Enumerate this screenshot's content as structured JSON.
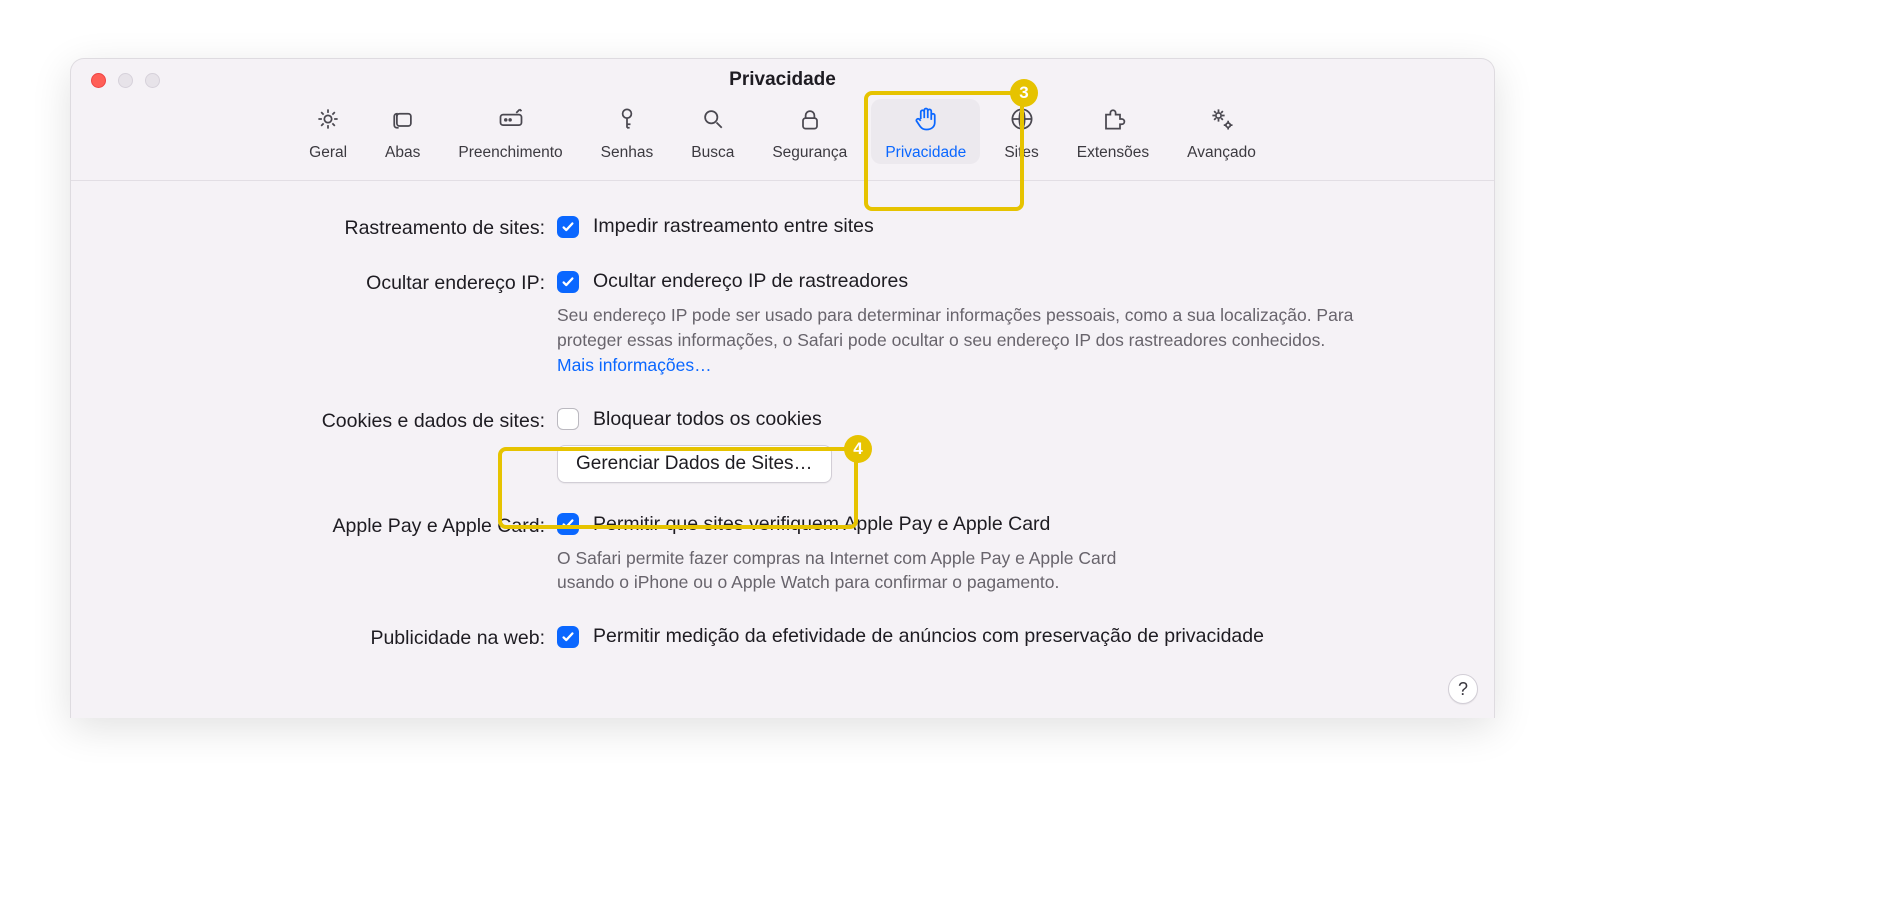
{
  "window": {
    "title": "Privacidade"
  },
  "tabs": [
    {
      "id": "general",
      "label": "Geral"
    },
    {
      "id": "tabs",
      "label": "Abas"
    },
    {
      "id": "autofill",
      "label": "Preenchimento"
    },
    {
      "id": "passwords",
      "label": "Senhas"
    },
    {
      "id": "search",
      "label": "Busca"
    },
    {
      "id": "security",
      "label": "Segurança"
    },
    {
      "id": "privacy",
      "label": "Privacidade",
      "active": true
    },
    {
      "id": "websites",
      "label": "Sites"
    },
    {
      "id": "extensions",
      "label": "Extensões"
    },
    {
      "id": "advanced",
      "label": "Avançado"
    }
  ],
  "sections": {
    "tracking": {
      "label": "Rastreamento de sites:",
      "cb": "Impedir rastreamento entre sites",
      "checked": true
    },
    "hideip": {
      "label": "Ocultar endereço IP:",
      "cb": "Ocultar endereço IP de rastreadores",
      "checked": true,
      "desc": "Seu endereço IP pode ser usado para determinar informações pessoais, como a sua localização. Para proteger essas informações, o Safari pode ocultar o seu endereço IP dos rastreadores conhecidos. ",
      "link": "Mais informações…"
    },
    "cookies": {
      "label": "Cookies e dados de sites:",
      "cb": "Bloquear todos os cookies",
      "checked": false,
      "button": "Gerenciar Dados de Sites…"
    },
    "applepay": {
      "label": "Apple Pay e Apple Card:",
      "cb": "Permitir que sites verifiquem Apple Pay e Apple Card",
      "checked": true,
      "desc": "O Safari permite fazer compras na Internet com Apple Pay e Apple Card usando o iPhone ou o Apple Watch para confirmar o pagamento."
    },
    "ads": {
      "label": "Publicidade na web:",
      "cb": "Permitir medição da efetividade de anúncios com preservação de privacidade",
      "checked": true
    }
  },
  "help": "?",
  "annotations": {
    "badge3": "3",
    "badge4": "4"
  }
}
